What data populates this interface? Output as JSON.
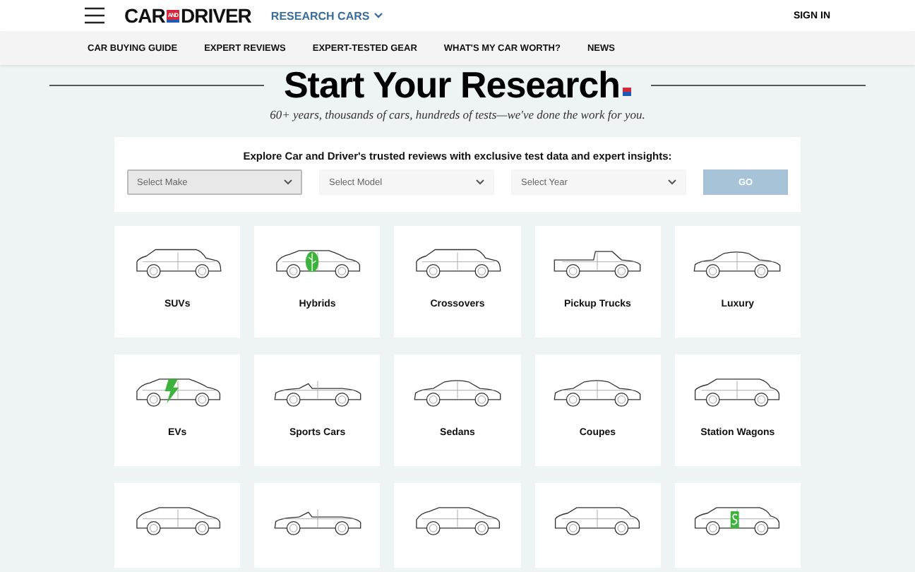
{
  "header": {
    "logo_left": "CAR",
    "logo_middle": "AND",
    "logo_right": "DRIVER",
    "menu": "RESEARCH CARS",
    "sign_in": "SIGN IN"
  },
  "nav": [
    "CAR BUYING GUIDE",
    "EXPERT REVIEWS",
    "EXPERT-TESTED GEAR",
    "WHAT'S MY CAR WORTH?",
    "NEWS"
  ],
  "hero": {
    "title": "Start Your Research",
    "subtitle": "60+ years, thousands of cars, hundreds of tests—we've done the work for you."
  },
  "search": {
    "prompt": "Explore Car and Driver's trusted reviews with exclusive test data and expert insights:",
    "selects": [
      {
        "placeholder": "Select Make",
        "disabled": false
      },
      {
        "placeholder": "Select Model",
        "disabled": true
      },
      {
        "placeholder": "Select Year",
        "disabled": true
      }
    ],
    "button": "GO"
  },
  "categories": [
    {
      "label": "SUVs",
      "kind": "plain"
    },
    {
      "label": "Hybrids",
      "kind": "leaf"
    },
    {
      "label": "Crossovers",
      "kind": "plain"
    },
    {
      "label": "Pickup Trucks",
      "kind": "plain"
    },
    {
      "label": "Luxury",
      "kind": "plain"
    },
    {
      "label": "EVs",
      "kind": "bolt"
    },
    {
      "label": "Sports Cars",
      "kind": "plain"
    },
    {
      "label": "Sedans",
      "kind": "plain"
    },
    {
      "label": "Coupes",
      "kind": "plain"
    },
    {
      "label": "Station Wagons",
      "kind": "plain"
    },
    {
      "kind": "plain"
    },
    {
      "kind": "plain"
    },
    {
      "kind": "plain"
    },
    {
      "kind": "plain"
    },
    {
      "kind": "dollar"
    }
  ]
}
